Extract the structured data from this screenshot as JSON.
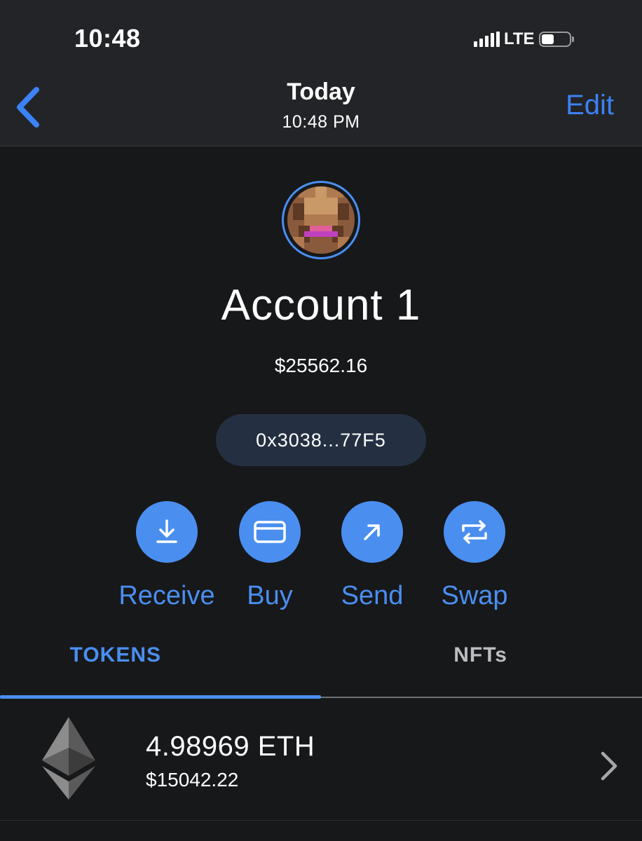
{
  "status_bar": {
    "time": "10:48",
    "network": "LTE",
    "battery_level": 0.45
  },
  "nav": {
    "title": "Today",
    "subtitle": "10:48 PM",
    "edit_label": "Edit"
  },
  "account": {
    "name": "Account 1",
    "balance": "$25562.16",
    "address": "0x3038...77F5"
  },
  "actions": [
    {
      "label": "Receive",
      "icon": "download-icon"
    },
    {
      "label": "Buy",
      "icon": "card-icon"
    },
    {
      "label": "Send",
      "icon": "arrow-up-right-icon"
    },
    {
      "label": "Swap",
      "icon": "swap-icon"
    }
  ],
  "tabs": {
    "tokens": "TOKENS",
    "nfts": "NFTs",
    "active": "tokens"
  },
  "tokens": [
    {
      "amount": "4.98969 ETH",
      "value": "$15042.22",
      "icon": "ethereum-icon"
    }
  ],
  "colors": {
    "accent": "#4a8ef0",
    "background": "#17181a",
    "header_background": "#232427",
    "address_pill": "#243041"
  }
}
